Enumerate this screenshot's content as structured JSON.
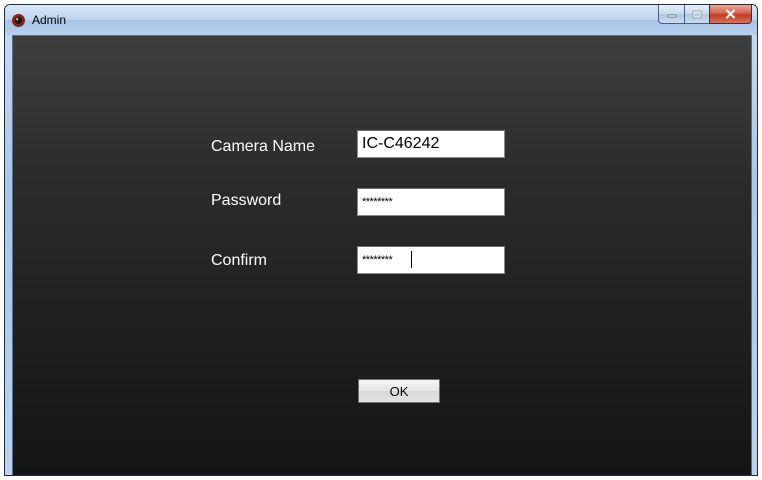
{
  "window": {
    "title": "Admin",
    "icon": "camera-app-icon",
    "caption_buttons": [
      "minimize-icon",
      "maximize-icon",
      "close-icon"
    ]
  },
  "form": {
    "camera_name_label": "Camera Name",
    "camera_name_value": "IC-C46242",
    "password_label": "Password",
    "password_value": "********",
    "confirm_label": "Confirm",
    "confirm_value": "********",
    "ok_label": "OK"
  },
  "colors": {
    "client_background_top": "#3e3e3e",
    "client_background_bottom": "#141414",
    "label_text": "#ffffff",
    "close_button": "#c23b22"
  }
}
